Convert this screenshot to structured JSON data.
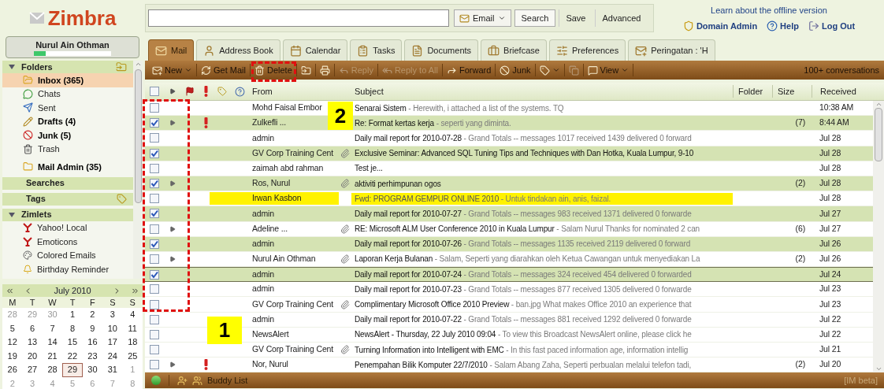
{
  "logo": "Zimbra",
  "user": {
    "name": "Nurul Ain Othman",
    "quota": {
      "level": 0.15
    }
  },
  "search": {
    "scope": "Email",
    "buttons": [
      "Search",
      "Save",
      "Advanced"
    ]
  },
  "header_links": {
    "offline": "Learn about the offline version",
    "links": [
      {
        "kind": "admin",
        "label": "Domain Admin"
      },
      {
        "kind": "help",
        "label": "Help"
      },
      {
        "kind": "logout",
        "label": "Log Out"
      }
    ]
  },
  "tabs": [
    {
      "kind": "mail",
      "label": "Mail",
      "selected": true
    },
    {
      "kind": "contacts",
      "label": "Address Book",
      "selected": false
    },
    {
      "kind": "calendar",
      "label": "Calendar",
      "selected": false
    },
    {
      "kind": "tasks",
      "label": "Tasks",
      "selected": false
    },
    {
      "kind": "documents",
      "label": "Documents",
      "selected": false
    },
    {
      "kind": "briefcase",
      "label": "Briefcase",
      "selected": false
    },
    {
      "kind": "preferences",
      "label": "Preferences",
      "selected": false
    },
    {
      "kind": "reminder",
      "label": "Peringatan : 'H",
      "selected": false
    }
  ],
  "toolbar": {
    "items": [
      {
        "kind": "new",
        "label": "New",
        "menu": true,
        "disabled": false
      },
      {
        "kind": "getmail",
        "label": "Get Mail",
        "menu": false,
        "disabled": false
      },
      {
        "kind": "delete",
        "label": "Delete",
        "menu": false,
        "disabled": false
      },
      {
        "kind": "move",
        "menu": false,
        "disabled": false
      },
      {
        "kind": "print",
        "menu": false,
        "disabled": false
      },
      {
        "kind": "reply",
        "label": "Reply",
        "menu": false,
        "disabled": true
      },
      {
        "kind": "replyall",
        "label": "Reply to All",
        "menu": false,
        "disabled": true
      },
      {
        "kind": "forward",
        "label": "Forward",
        "menu": false,
        "disabled": false
      },
      {
        "kind": "junk",
        "label": "Junk",
        "menu": false,
        "disabled": false
      },
      {
        "kind": "tag",
        "menu": true,
        "disabled": false
      },
      {
        "kind": "detach",
        "menu": false,
        "disabled": true
      },
      {
        "kind": "view",
        "label": "View",
        "menu": true,
        "disabled": false
      }
    ],
    "count": "100+ conversations"
  },
  "folders": {
    "title": "Folders",
    "items": [
      {
        "kind": "inbox",
        "label": "Inbox (365)",
        "unread": true,
        "selected": true
      },
      {
        "kind": "chats",
        "label": "Chats",
        "unread": false,
        "selected": false
      },
      {
        "kind": "sent",
        "label": "Sent",
        "unread": false,
        "selected": false
      },
      {
        "kind": "drafts",
        "label": "Drafts (4)",
        "unread": true,
        "selected": false
      },
      {
        "kind": "junk",
        "label": "Junk (5)",
        "unread": true,
        "selected": false
      },
      {
        "kind": "trash",
        "label": "Trash",
        "unread": false,
        "selected": false
      },
      {
        "kind": "folder",
        "label": "Mail Admin (35)",
        "unread": true,
        "selected": false
      }
    ]
  },
  "searches": {
    "title": "Searches"
  },
  "tags": {
    "title": "Tags"
  },
  "zimlets": {
    "title": "Zimlets",
    "items": [
      {
        "kind": "yahoo",
        "label": "Yahoo! Local"
      },
      {
        "kind": "yahoo",
        "label": "Emoticons"
      },
      {
        "kind": "colors",
        "label": "Colored Emails"
      },
      {
        "kind": "bell",
        "label": "Birthday Reminder"
      }
    ]
  },
  "calendar": {
    "month": "July 2010",
    "weekdays": [
      "M",
      "T",
      "W",
      "T",
      "F",
      "S",
      "S"
    ],
    "days": [
      {
        "d": "28",
        "other": true,
        "today": false
      },
      {
        "d": "29",
        "other": true,
        "today": false
      },
      {
        "d": "30",
        "other": true,
        "today": false
      },
      {
        "d": "1",
        "other": false,
        "today": false
      },
      {
        "d": "2",
        "other": false,
        "today": false
      },
      {
        "d": "3",
        "other": false,
        "today": false
      },
      {
        "d": "4",
        "other": false,
        "today": false
      },
      {
        "d": "5",
        "other": false,
        "today": false
      },
      {
        "d": "6",
        "other": false,
        "today": false
      },
      {
        "d": "7",
        "other": false,
        "today": false
      },
      {
        "d": "8",
        "other": false,
        "today": false
      },
      {
        "d": "9",
        "other": false,
        "today": false
      },
      {
        "d": "10",
        "other": false,
        "today": false
      },
      {
        "d": "11",
        "other": false,
        "today": false
      },
      {
        "d": "12",
        "other": false,
        "today": false
      },
      {
        "d": "13",
        "other": false,
        "today": false
      },
      {
        "d": "14",
        "other": false,
        "today": false
      },
      {
        "d": "15",
        "other": false,
        "today": false
      },
      {
        "d": "16",
        "other": false,
        "today": false
      },
      {
        "d": "17",
        "other": false,
        "today": false
      },
      {
        "d": "18",
        "other": false,
        "today": false
      },
      {
        "d": "19",
        "other": false,
        "today": false
      },
      {
        "d": "20",
        "other": false,
        "today": false
      },
      {
        "d": "21",
        "other": false,
        "today": false
      },
      {
        "d": "22",
        "other": false,
        "today": false
      },
      {
        "d": "23",
        "other": false,
        "today": false
      },
      {
        "d": "24",
        "other": false,
        "today": false
      },
      {
        "d": "25",
        "other": false,
        "today": false
      },
      {
        "d": "26",
        "other": false,
        "today": false
      },
      {
        "d": "27",
        "other": false,
        "today": false
      },
      {
        "d": "28",
        "other": false,
        "today": false
      },
      {
        "d": "29",
        "other": false,
        "today": true
      },
      {
        "d": "30",
        "other": false,
        "today": false
      },
      {
        "d": "31",
        "other": false,
        "today": false
      },
      {
        "d": "1",
        "other": true,
        "today": false
      },
      {
        "d": "2",
        "other": true,
        "today": false
      },
      {
        "d": "3",
        "other": true,
        "today": false
      },
      {
        "d": "4",
        "other": true,
        "today": false
      },
      {
        "d": "5",
        "other": true,
        "today": false
      },
      {
        "d": "6",
        "other": true,
        "today": false
      },
      {
        "d": "7",
        "other": true,
        "today": false
      },
      {
        "d": "8",
        "other": true,
        "today": false
      }
    ]
  },
  "messages": {
    "select_all": {
      "checked": false
    },
    "columns": [
      "From",
      "Subject",
      "Folder",
      "Size",
      "Received"
    ],
    "rows": [
      {
        "from": "Mohd Faisal Embor",
        "subject": "Senarai Sistem",
        "fragment": " - Herewith, i attached a list of the systems. TQ",
        "size": "",
        "received": "10:38 AM",
        "checked": false,
        "thread": false,
        "priority": false,
        "highlighted": false,
        "focused": false
      },
      {
        "from": "Zulkefli ...",
        "subject": "Re: Format kertas kerja",
        "fragment": " - seperti yang diminta.",
        "size": "(7)",
        "received": "8:44 AM",
        "checked": true,
        "thread": true,
        "priority": true,
        "attachment": false,
        "highlighted": false,
        "focused": false
      },
      {
        "from": "admin",
        "subject": "Daily mail report for 2010-07-28",
        "fragment": " - Grand Totals -- messages 1017 received 1439 delivered 0 forward",
        "size": "",
        "received": "Jul 28",
        "checked": false,
        "thread": false,
        "priority": false,
        "attachment": false,
        "highlighted": false,
        "focused": false
      },
      {
        "from": "GV Corp Training Cent",
        "subject": "Exclusive Seminar: Advanced SQL Tuning Tips and Techniques with Dan Hotka, Kuala Lumpur, 9-10",
        "fragment": "",
        "size": "",
        "received": "Jul 28",
        "checked": true,
        "thread": false,
        "priority": false,
        "attachment": true,
        "highlighted": false,
        "focused": false
      },
      {
        "from": "zaimah abd rahman",
        "subject": "Test je...",
        "fragment": "",
        "size": "",
        "received": "Jul 28",
        "checked": false,
        "thread": false,
        "priority": false,
        "attachment": false,
        "highlighted": false,
        "focused": false
      },
      {
        "from": "Ros, Nurul",
        "subject": "aktiviti perhimpunan ogos",
        "fragment": "",
        "size": "(2)",
        "received": "Jul 28",
        "checked": true,
        "thread": true,
        "priority": false,
        "attachment": true,
        "highlighted": false,
        "focused": false
      },
      {
        "from": "Irwan Kasbon",
        "subject": "Fwd: PROGRAM GEMPUR ONLINE 2010",
        "fragment": " - Untuk tindakan ain, anis, faizal.",
        "size": "",
        "received": "Jul 28",
        "checked": false,
        "thread": false,
        "priority": false,
        "attachment": false,
        "highlighted": true,
        "focused": false
      },
      {
        "from": "admin",
        "subject": "Daily mail report for 2010-07-27",
        "fragment": " - Grand Totals -- messages 983 received 1371 delivered 0 forwarde",
        "size": "",
        "received": "Jul 27",
        "checked": true,
        "thread": false,
        "priority": false,
        "attachment": false,
        "highlighted": false,
        "focused": false
      },
      {
        "from": "Adeline ...",
        "subject": "RE: Microsoft ALM User Conference 2010 in Kuala Lumpur",
        "fragment": " - Salam Nurul Thanks for nominated 2 can",
        "size": "(6)",
        "received": "Jul 27",
        "checked": false,
        "thread": true,
        "priority": false,
        "attachment": true,
        "highlighted": false,
        "focused": false
      },
      {
        "from": "admin",
        "subject": "Daily mail report for 2010-07-26",
        "fragment": " - Grand Totals -- messages 1135 received 2119 delivered 0 forward",
        "size": "",
        "received": "Jul 26",
        "checked": true,
        "thread": false,
        "priority": false,
        "attachment": false,
        "highlighted": false,
        "focused": false
      },
      {
        "from": "Nurul Ain Othman",
        "subject": "Laporan Kerja Bulanan",
        "fragment": " - Salam, Seperti yang diarahkan oleh Ketua Cawangan untuk menyediakan La",
        "size": "(2)",
        "received": "Jul 26",
        "checked": false,
        "thread": true,
        "priority": false,
        "attachment": true,
        "highlighted": false,
        "focused": false
      },
      {
        "from": "admin",
        "subject": "Daily mail report for 2010-07-24",
        "fragment": " - Grand Totals -- messages 324 received 454 delivered 0 forwarded",
        "size": "",
        "received": "Jul 24",
        "checked": true,
        "thread": false,
        "priority": false,
        "attachment": false,
        "highlighted": false,
        "focused": true
      },
      {
        "from": "admin",
        "subject": "Daily mail report for 2010-07-23",
        "fragment": " - Grand Totals -- messages 877 received 1305 delivered 0 forwarde",
        "size": "",
        "received": "Jul 23",
        "checked": false,
        "thread": false,
        "priority": false,
        "attachment": false,
        "highlighted": false,
        "focused": false
      },
      {
        "from": "GV Corp Training Cent",
        "subject": "Complimentary Microsoft Office 2010 Preview",
        "fragment": " - ban.jpg What makes Office 2010 an experience that",
        "size": "",
        "received": "Jul 23",
        "checked": false,
        "thread": false,
        "priority": false,
        "attachment": true,
        "highlighted": false,
        "focused": false
      },
      {
        "from": "admin",
        "subject": "Daily mail report for 2010-07-22",
        "fragment": " - Grand Totals -- messages 881 received 1292 delivered 0 forwarde",
        "size": "",
        "received": "Jul 22",
        "checked": false,
        "thread": false,
        "priority": false,
        "attachment": false,
        "highlighted": false,
        "focused": false
      },
      {
        "from": "NewsAlert",
        "subject": "NewsAlert - Thursday, 22 July 2010 09:04",
        "fragment": " - To view this Broadcast NewsAlert online, please click he",
        "size": "",
        "received": "Jul 22",
        "checked": false,
        "thread": false,
        "priority": false,
        "attachment": false,
        "highlighted": false,
        "focused": false
      },
      {
        "from": "GV Corp Training Cent",
        "subject": "Turning Information into Intelligent with EMC",
        "fragment": " - In this fast paced information age, information intellig",
        "size": "",
        "received": "Jul 21",
        "checked": false,
        "thread": false,
        "priority": false,
        "attachment": true,
        "highlighted": false,
        "focused": false
      },
      {
        "from": "Nor, Nurul",
        "subject": "Penempahan Bilik Komputer 22/7/2010",
        "fragment": " - Salam Abang Zaha, Seperti perbualan melalui telefon tadi,",
        "size": "(2)",
        "received": "Jul 20",
        "checked": false,
        "thread": true,
        "priority": true,
        "attachment": false,
        "highlighted": false,
        "focused": false
      }
    ]
  },
  "footer": {
    "buddy_list": "Buddy List",
    "im_note": "[IM beta]"
  },
  "annotations": [
    {
      "kind": "checkbox-column",
      "label": "1"
    },
    {
      "kind": "delete-button",
      "label": "2"
    }
  ]
}
